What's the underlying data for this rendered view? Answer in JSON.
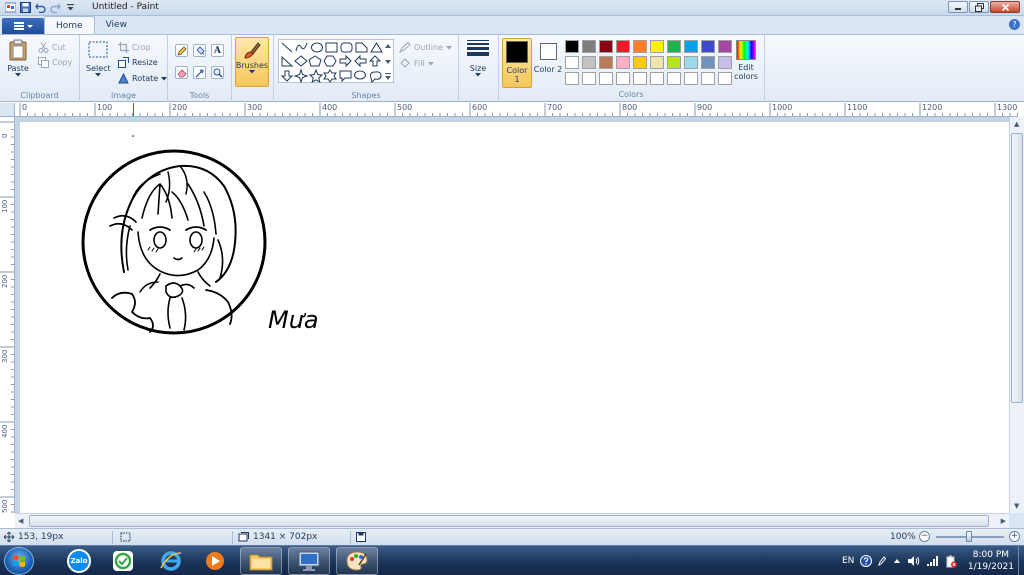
{
  "window": {
    "title": "Untitled - Paint"
  },
  "ribbon": {
    "tabs": [
      "Home",
      "View"
    ],
    "clipboard": {
      "paste": "Paste",
      "cut": "Cut",
      "copy": "Copy",
      "label": "Clipboard"
    },
    "image": {
      "select": "Select",
      "crop": "Crop",
      "resize": "Resize",
      "rotate": "Rotate",
      "label": "Image"
    },
    "tools": {
      "label": "Tools",
      "text_glyph": "A"
    },
    "brushes": {
      "label": "Brushes"
    },
    "shapes": {
      "outline": "Outline",
      "fill": "Fill",
      "label": "Shapes"
    },
    "size": {
      "label": "Size"
    },
    "colors": {
      "color1": "Color 1",
      "color2": "Color 2",
      "edit": "Edit colors",
      "label": "Colors",
      "color1_value": "#000000",
      "color2_value": "#ffffff",
      "palette": [
        "#000000",
        "#7f7f7f",
        "#880015",
        "#ed1c24",
        "#ff7f27",
        "#fff200",
        "#22b14c",
        "#00a2e8",
        "#3f48cc",
        "#a349a4",
        "#ffffff",
        "#c3c3c3",
        "#b97a57",
        "#ffaec9",
        "#ffc90e",
        "#efe4b0",
        "#b5e61d",
        "#99d9ea",
        "#7092be",
        "#c8bfe7",
        "#ffffff",
        "#ffffff",
        "#ffffff",
        "#ffffff",
        "#ffffff",
        "#ffffff",
        "#ffffff",
        "#ffffff",
        "#ffffff",
        "#ffffff"
      ]
    }
  },
  "rulers": {
    "horizontal": [
      "0",
      "100",
      "200",
      "300",
      "400",
      "500",
      "600",
      "700",
      "800",
      "900",
      "1000",
      "1100",
      "1200",
      "1300"
    ],
    "vertical": [
      "0",
      "100",
      "200",
      "300",
      "400",
      "500"
    ]
  },
  "canvas": {
    "signature": "Mưa"
  },
  "statusbar": {
    "cursor_position": "153, 19px",
    "canvas_size": "1341 × 702px",
    "zoom": "100%"
  },
  "taskbar": {
    "apps": [
      "zalo",
      "app-icon",
      "internet-explorer",
      "media-player",
      "file-explorer",
      "monitor",
      "paint"
    ],
    "zalo_label": "Zalo",
    "language": "EN",
    "time": "8:00 PM",
    "date": "1/19/2021"
  }
}
